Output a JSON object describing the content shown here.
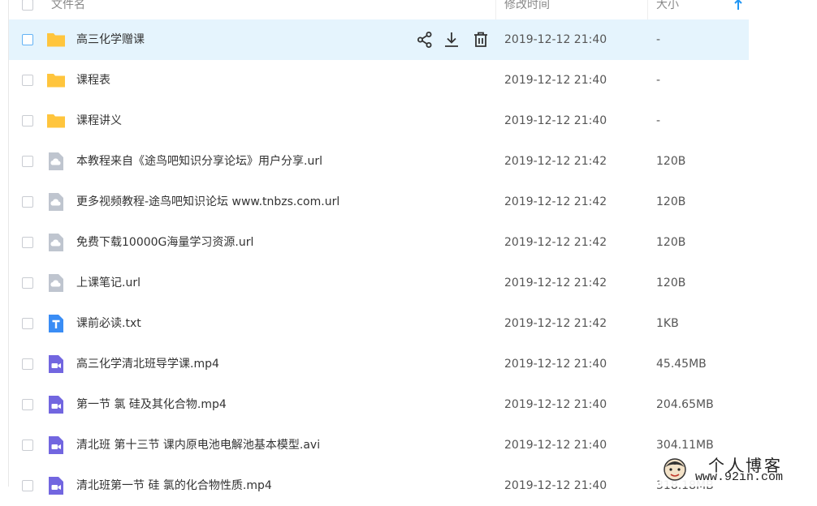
{
  "header": {
    "name_col": "文件名",
    "time_col": "修改时间",
    "size_col": "大小",
    "sort_icon": "arrow-up-icon"
  },
  "hover_actions": [
    "share-icon",
    "download-icon",
    "delete-icon"
  ],
  "files": [
    {
      "type": "folder",
      "name": "高三化学赠课",
      "time": "2019-12-12 21:40",
      "size": "-",
      "hover": true
    },
    {
      "type": "folder",
      "name": "课程表",
      "time": "2019-12-12 21:40",
      "size": "-"
    },
    {
      "type": "folder",
      "name": "课程讲义",
      "time": "2019-12-12 21:40",
      "size": "-"
    },
    {
      "type": "url",
      "name": "本教程来自《途鸟吧知识分享论坛》用户分享.url",
      "time": "2019-12-12 21:42",
      "size": "120B"
    },
    {
      "type": "url",
      "name": "更多视频教程-途鸟吧知识论坛 www.tnbzs.com.url",
      "time": "2019-12-12 21:42",
      "size": "120B"
    },
    {
      "type": "url",
      "name": "免费下载10000G海量学习资源.url",
      "time": "2019-12-12 21:42",
      "size": "120B"
    },
    {
      "type": "url",
      "name": "上课笔记.url",
      "time": "2019-12-12 21:42",
      "size": "120B"
    },
    {
      "type": "txt",
      "name": "课前必读.txt",
      "time": "2019-12-12 21:42",
      "size": "1KB"
    },
    {
      "type": "video",
      "name": "高三化学清北班导学课.mp4",
      "time": "2019-12-12 21:40",
      "size": "45.45MB"
    },
    {
      "type": "video",
      "name": "第一节 氯 硅及其化合物.mp4",
      "time": "2019-12-12 21:40",
      "size": "204.65MB"
    },
    {
      "type": "video",
      "name": "清北班 第十三节 课内原电池电解池基本模型.avi",
      "time": "2019-12-12 21:40",
      "size": "304.11MB"
    },
    {
      "type": "video",
      "name": "清北班第一节 硅 氯的化合物性质.mp4",
      "time": "2019-12-12 21:40",
      "size": "318.18MB"
    }
  ],
  "colors": {
    "folder": "#ffc53d",
    "cloud_file": "#bfc5cf",
    "txt": "#3a8df5",
    "video": "#7266e0",
    "hover_row": "#e5f4fd",
    "accent": "#2196f3"
  },
  "watermark": {
    "title": "个人博客",
    "url": "www.92in.com"
  }
}
